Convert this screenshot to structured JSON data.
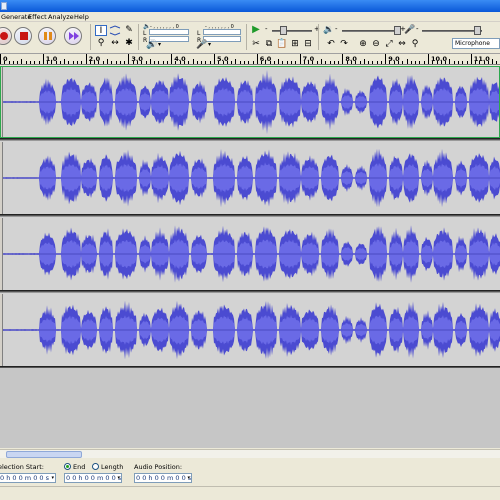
{
  "menu": [
    "Generate",
    "Effect",
    "Analyze",
    "Help"
  ],
  "meters": {
    "left_channel": "L",
    "right_channel": "R",
    "play_ticks": "-  ,  ,  ,  ,  ,  ,  ,  0",
    "rec_ticks": "-  ,  ,  ,  ,  ,  ,  ,  0"
  },
  "mixer": {
    "input_device": "Microphone",
    "minus_sign": "-",
    "plus_sign": "+"
  },
  "ruler": {
    "ticks": [
      "0",
      "1.0",
      "2.0",
      "3.0",
      "4.0",
      "5.0",
      "6.0",
      "7.0",
      "8.0",
      "9.0",
      "10.0",
      "11.0"
    ]
  },
  "tracks": {
    "count": 4,
    "waveform_color": "#4b4bd1",
    "rms_color": "#6a6ae6",
    "background": "#d3d3d3"
  },
  "selection_toolbar": {
    "selection_start_label": "election Start:",
    "end_label": "End",
    "length_label": "Length",
    "audio_position_label": "Audio Position:",
    "end_selected": true,
    "selection_start_value": "0 h 0 0 m 0 0 s",
    "end_value": "0 0 h 0 0 m 0 0 s",
    "audio_position_value": "0 0 h 0 0 m 0 0 s"
  },
  "colors": {
    "play": "#1f9a2a",
    "record": "#c81414",
    "pause": "#3f78d8",
    "skip": "#7f3fe0",
    "selection": "#2ca84d"
  }
}
